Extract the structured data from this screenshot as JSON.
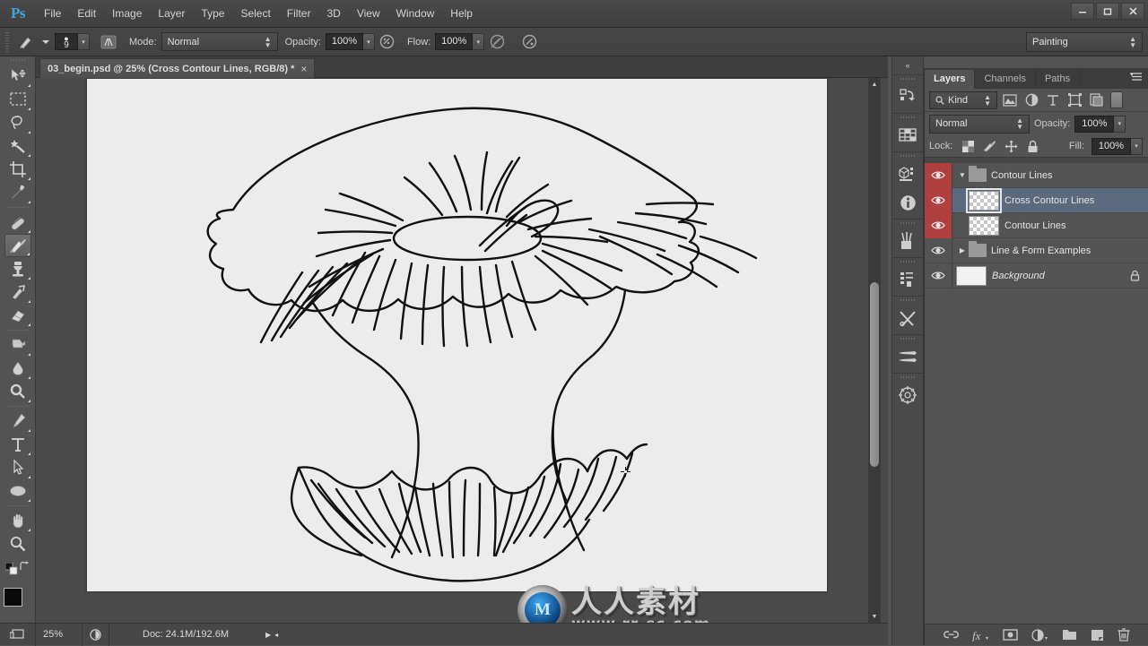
{
  "app": {
    "name": "Ps",
    "logo_color": "#3ea8dd"
  },
  "menubar": {
    "items": [
      "File",
      "Edit",
      "Image",
      "Layer",
      "Type",
      "Select",
      "Filter",
      "3D",
      "View",
      "Window",
      "Help"
    ]
  },
  "window_controls": {
    "minimize": "–",
    "maximize": "□",
    "close": "✕"
  },
  "options_bar": {
    "brush_size": "9",
    "mode_label": "Mode:",
    "mode_value": "Normal",
    "opacity_label": "Opacity:",
    "opacity_value": "100%",
    "flow_label": "Flow:",
    "flow_value": "100%",
    "workspace_value": "Painting",
    "icons": [
      "brush-preset-picker-icon",
      "brush-panel-toggle-icon",
      "airbrush-icon",
      "tablet-pressure-opacity-icon",
      "tablet-pressure-size-icon"
    ]
  },
  "tools": [
    {
      "name": "move-tool",
      "active": false
    },
    {
      "name": "rectangular-marquee-tool",
      "active": false
    },
    {
      "name": "lasso-tool",
      "active": false
    },
    {
      "name": "magic-wand-tool",
      "active": false
    },
    {
      "name": "crop-tool",
      "active": false
    },
    {
      "name": "eyedropper-tool",
      "active": false
    },
    {
      "name": "spot-healing-brush-tool",
      "active": false
    },
    {
      "name": "brush-tool",
      "active": true
    },
    {
      "name": "clone-stamp-tool",
      "active": false
    },
    {
      "name": "history-brush-tool",
      "active": false
    },
    {
      "name": "eraser-tool",
      "active": false
    },
    {
      "name": "gradient-tool",
      "active": false
    },
    {
      "name": "blur-tool",
      "active": false
    },
    {
      "name": "dodge-tool",
      "active": false
    },
    {
      "name": "pen-tool",
      "active": false
    },
    {
      "name": "type-tool",
      "active": false
    },
    {
      "name": "path-selection-tool",
      "active": false
    },
    {
      "name": "ellipse-tool",
      "active": false
    },
    {
      "name": "hand-tool",
      "active": false
    },
    {
      "name": "zoom-tool",
      "active": false
    }
  ],
  "color_swatches": {
    "foreground": "#0a0a0a",
    "background": "#f3f3f3"
  },
  "document": {
    "tab_title": "03_begin.psd @ 25% (Cross Contour Lines, RGB/8) *",
    "close_label": "×",
    "canvas_background": "#ececec",
    "artwork": "mushroom-cross-contour-line-drawing"
  },
  "watermark": {
    "logo_letter": "M",
    "chinese": "人人素材",
    "url": "www.rr-sc.com"
  },
  "status_bar": {
    "zoom": "25%",
    "doc_info": "Doc: 24.1M/192.6M",
    "arrow": "▶"
  },
  "icon_dock": {
    "collapse": "«",
    "items": [
      "history-icon",
      "swatches-grid-icon",
      "3d-icon",
      "info-icon",
      "adjustments-icon",
      "layer-comps-icon",
      "tool-presets-icon",
      "brush-presets-icon",
      "navigator-icon"
    ]
  },
  "layers_panel": {
    "tabs": [
      {
        "label": "Layers",
        "active": true
      },
      {
        "label": "Channels",
        "active": false
      },
      {
        "label": "Paths",
        "active": false
      }
    ],
    "menu_icon": "panel-menu-icon",
    "filter": {
      "search_icon": "search-icon",
      "kind_label": "Kind",
      "type_filters": [
        "filter-pixel-icon",
        "filter-adjustment-icon",
        "filter-type-icon",
        "filter-shape-icon",
        "filter-smartobject-icon"
      ],
      "toggle_icon": "filter-enable-toggle"
    },
    "blend_mode": "Normal",
    "opacity_label": "Opacity:",
    "opacity_value": "100%",
    "lock_label": "Lock:",
    "lock_icons": [
      "lock-transparent-pixels-icon",
      "lock-image-pixels-icon",
      "lock-position-icon",
      "lock-all-icon"
    ],
    "fill_label": "Fill:",
    "fill_value": "100%",
    "layers": [
      {
        "name": "Contour Lines",
        "type": "group",
        "expanded": true,
        "visible": true,
        "selected": false,
        "color_label": "#b0403f",
        "indent": 0,
        "locked": false
      },
      {
        "name": "Cross Contour Lines",
        "type": "pixel",
        "visible": true,
        "selected": true,
        "color_label": "#b0403f",
        "indent": 1,
        "locked": false
      },
      {
        "name": "Contour Lines",
        "type": "pixel",
        "visible": true,
        "selected": false,
        "color_label": "#b0403f",
        "indent": 1,
        "locked": false
      },
      {
        "name": "Line & Form Examples",
        "type": "group",
        "expanded": false,
        "visible": true,
        "selected": false,
        "color_label": "",
        "indent": 0,
        "locked": false
      },
      {
        "name": "Background",
        "type": "background",
        "visible": true,
        "selected": false,
        "color_label": "",
        "indent": 0,
        "locked": true
      }
    ],
    "footer_icons": [
      "link-layers-icon",
      "add-layer-style-icon",
      "add-layer-mask-icon",
      "new-adjustment-layer-icon",
      "new-group-icon",
      "new-layer-icon",
      "delete-layer-icon"
    ]
  }
}
